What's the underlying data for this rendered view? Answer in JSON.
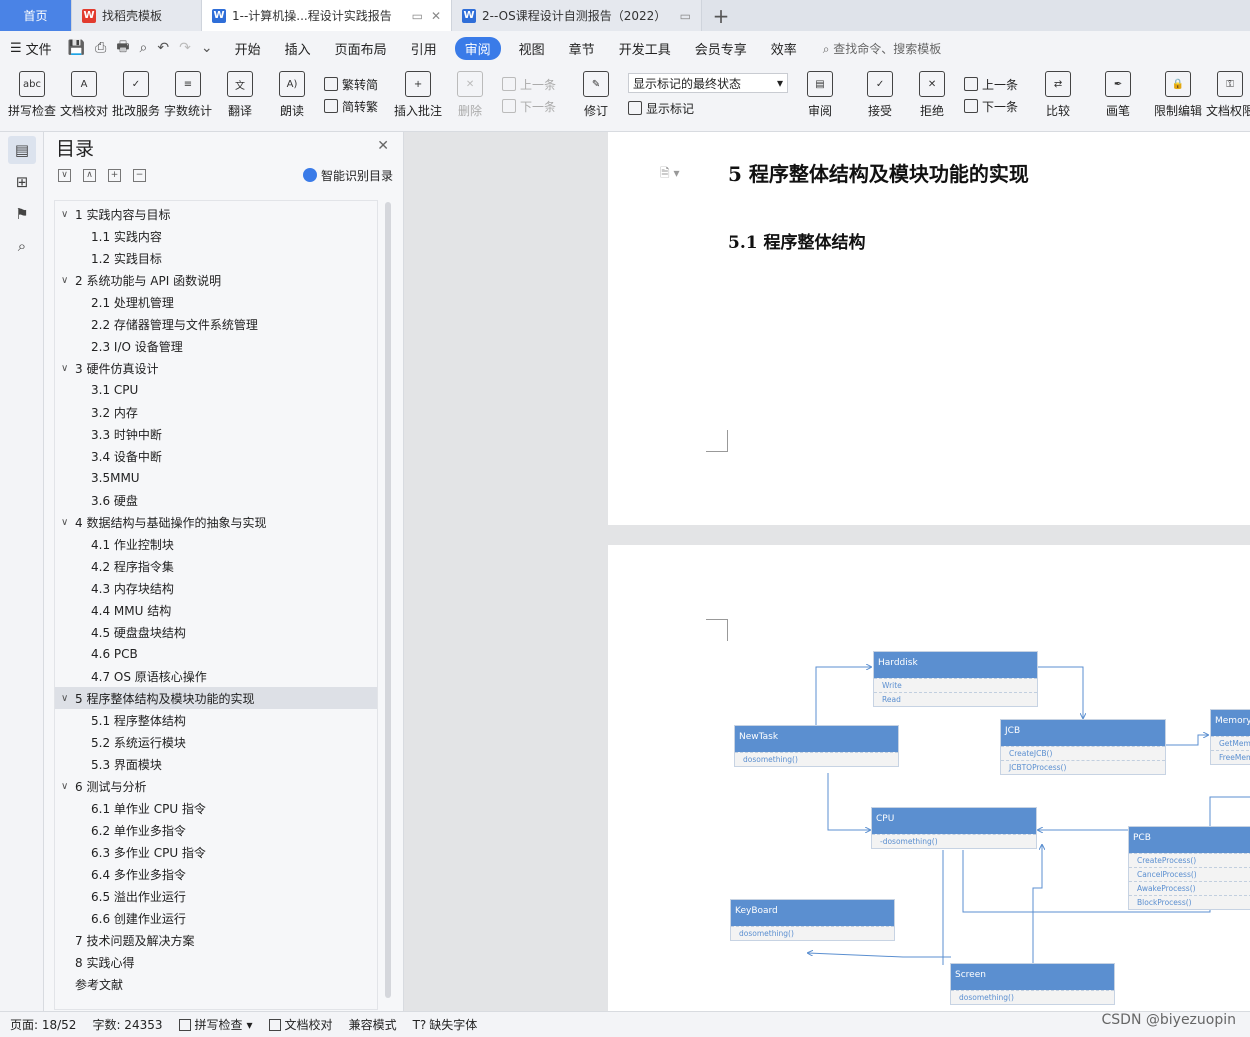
{
  "tabs": {
    "home": "首页",
    "t1": "找稻壳模板",
    "t2": "1--计算机操...程设计实践报告",
    "t3": "2--OS课程设计自测报告（2022）",
    "add": "+"
  },
  "menu": {
    "file": "文件",
    "items": [
      "开始",
      "插入",
      "页面布局",
      "引用",
      "审阅",
      "视图",
      "章节",
      "开发工具",
      "会员专享",
      "效率"
    ],
    "search": "查找命令、搜索模板"
  },
  "ribbon": {
    "spell": "拼写检查",
    "doccheck": "文档校对",
    "correction": "批改服务",
    "wordcount": "字数统计",
    "translate": "翻译",
    "read": "朗读",
    "trad": "繁转简",
    "simp": "简转繁",
    "insert_comment": "插入批注",
    "delete": "删除",
    "prev_comment": "上一条",
    "next_comment": "下一条",
    "revise": "修订",
    "show_state": "显示标记的最终状态",
    "show_marks": "显示标记",
    "review": "审阅",
    "accept": "接受",
    "reject": "拒绝",
    "prev": "上一条",
    "next": "下一条",
    "compare": "比较",
    "pen": "画笔",
    "restrict": "限制编辑",
    "permission": "文档权限"
  },
  "toc": {
    "title": "目录",
    "smart": "智能识别目录",
    "items": [
      {
        "text": "1  实践内容与目标",
        "level": 1,
        "chev": "∨"
      },
      {
        "text": "1.1 实践内容",
        "level": 2
      },
      {
        "text": "1.2 实践目标",
        "level": 2
      },
      {
        "text": "2  系统功能与  API  函数说明",
        "level": 1,
        "chev": "∨"
      },
      {
        "text": "2.1 处理机管理",
        "level": 2
      },
      {
        "text": "2.2  存储器管理与文件系统管理",
        "level": 2
      },
      {
        "text": "2.3 I/O 设备管理",
        "level": 2
      },
      {
        "text": "3  硬件仿真设计",
        "level": 1,
        "chev": "∨"
      },
      {
        "text": "3.1 CPU",
        "level": 2
      },
      {
        "text": "3.2 内存",
        "level": 2
      },
      {
        "text": "3.3 时钟中断",
        "level": 2
      },
      {
        "text": "3.4 设备中断",
        "level": 2
      },
      {
        "text": "3.5MMU",
        "level": 2
      },
      {
        "text": "3.6 硬盘",
        "level": 2
      },
      {
        "text": "4  数据结构与基础操作的抽象与实现",
        "level": 1,
        "chev": "∨"
      },
      {
        "text": "4.1  作业控制块",
        "level": 2
      },
      {
        "text": "4.2  程序指令集",
        "level": 2
      },
      {
        "text": "4.3  内存块结构",
        "level": 2
      },
      {
        "text": "4.4    MMU 结构",
        "level": 2
      },
      {
        "text": "4.5  硬盘盘块结构",
        "level": 2
      },
      {
        "text": "4.6 PCB",
        "level": 2
      },
      {
        "text": "4.7 OS 原语核心操作",
        "level": 2
      },
      {
        "text": "5  程序整体结构及模块功能的实现",
        "level": 1,
        "chev": "∨",
        "selected": true
      },
      {
        "text": "5.1  程序整体结构",
        "level": 2
      },
      {
        "text": "5.2  系统运行模块",
        "level": 2
      },
      {
        "text": "5.3  界面模块",
        "level": 2
      },
      {
        "text": "6  测试与分析",
        "level": 1,
        "chev": "∨"
      },
      {
        "text": "6.1  单作业 CPU 指令",
        "level": 2
      },
      {
        "text": "6.2  单作业多指令",
        "level": 2
      },
      {
        "text": "6.3  多作业 CPU 指令",
        "level": 2
      },
      {
        "text": "6.4  多作业多指令",
        "level": 2
      },
      {
        "text": "6.5  溢出作业运行",
        "level": 2
      },
      {
        "text": "6.6  创建作业运行",
        "level": 2
      },
      {
        "text": "7  技术问题及解决方案",
        "level": 0
      },
      {
        "text": "8  实践心得",
        "level": 0
      },
      {
        "text": "参考文献",
        "level": 0
      }
    ]
  },
  "doc": {
    "heading1": "5  程序整体结构及模块功能的实现",
    "heading2": "5.1  程序整体结构",
    "uml": {
      "harddisk": {
        "title": "Harddisk",
        "methods": [
          "Write",
          "Read"
        ]
      },
      "jcb": {
        "title": "JCB",
        "methods": [
          "CreateJCB()",
          "JCBTOProcess()"
        ]
      },
      "memory": {
        "title": "Memory",
        "methods": [
          "GetMem",
          "FreeMem"
        ]
      },
      "newtask": {
        "title": "NewTask",
        "methods": [
          "dosomething()"
        ]
      },
      "cpu": {
        "title": "CPU",
        "methods": [
          "-dosomething()"
        ]
      },
      "pcb": {
        "title": "PCB",
        "methods": [
          "CreateProcess()",
          "CancelProcess()",
          "AwakeProcess()",
          "BlockProcess()"
        ]
      },
      "keyboard": {
        "title": "KeyBoard",
        "methods": [
          "dosomething()"
        ]
      },
      "screen": {
        "title": "Screen",
        "methods": [
          "dosomething()"
        ]
      }
    }
  },
  "status": {
    "page": "页面: 18/52",
    "words": "字数: 24353",
    "spell": "拼写检查",
    "doccheck": "文档校对",
    "compat": "兼容模式",
    "missing_font": "缺失字体"
  },
  "watermark": "CSDN @biyezuopin"
}
